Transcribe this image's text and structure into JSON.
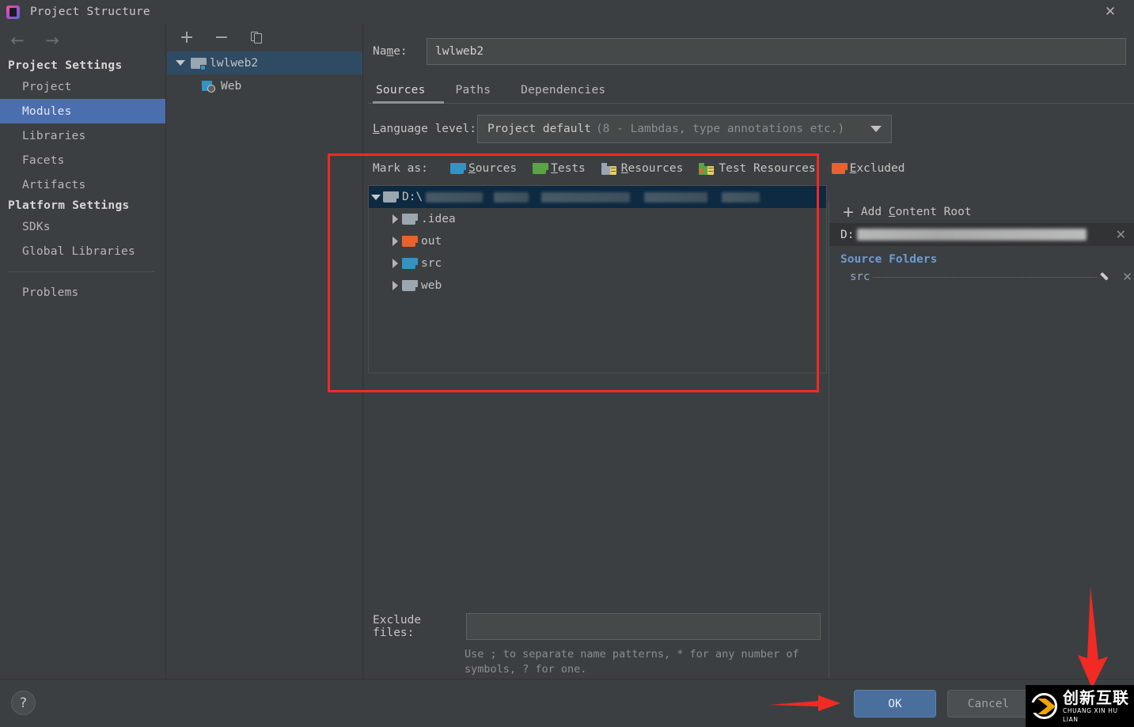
{
  "window": {
    "title": "Project Structure",
    "app_icon": "intellij-idea-icon",
    "close_label": "✕"
  },
  "sidebar": {
    "nav": {
      "back": "←",
      "forward": "→"
    },
    "groups": [
      {
        "label": "Project Settings",
        "items": [
          {
            "label": "Project",
            "selected": false
          },
          {
            "label": "Modules",
            "selected": true
          },
          {
            "label": "Libraries",
            "selected": false
          },
          {
            "label": "Facets",
            "selected": false
          },
          {
            "label": "Artifacts",
            "selected": false
          }
        ]
      },
      {
        "label": "Platform Settings",
        "items": [
          {
            "label": "SDKs",
            "selected": false
          },
          {
            "label": "Global Libraries",
            "selected": false
          }
        ]
      }
    ],
    "footer_items": [
      {
        "label": "Problems",
        "selected": false
      }
    ]
  },
  "modules_panel": {
    "toolbar": {
      "add": "+",
      "remove": "−",
      "copy_icon": "copy-icon"
    },
    "tree": [
      {
        "label": "lwlweb2",
        "icon": "module-folder-icon",
        "selected": true,
        "expanded": true,
        "depth": 0
      },
      {
        "label": "Web",
        "icon": "web-facet-icon",
        "selected": false,
        "depth": 1
      }
    ]
  },
  "main": {
    "name_label": "Name:",
    "name_value": "lwlweb2",
    "tabs": [
      {
        "label": "Sources",
        "active": true
      },
      {
        "label": "Paths",
        "active": false
      },
      {
        "label": "Dependencies",
        "active": false
      }
    ],
    "language_level": {
      "label": "Language level:",
      "value": "Project default",
      "detail": "(8 - Lambdas, type annotations etc.)"
    },
    "mark_as": {
      "label": "Mark as:",
      "options": [
        {
          "label": "Sources",
          "icon": "folder-blue-icon",
          "accel": "S"
        },
        {
          "label": "Tests",
          "icon": "folder-green-icon",
          "accel": "T"
        },
        {
          "label": "Resources",
          "icon": "resources-grey-icon",
          "accel": "R"
        },
        {
          "label": "Test Resources",
          "icon": "test-resources-icon",
          "accel": ""
        },
        {
          "label": "Excluded",
          "icon": "folder-orange-icon",
          "accel": "E"
        }
      ]
    },
    "file_tree": [
      {
        "label": "D:\\",
        "icon": "folder-grey-icon",
        "depth": 0,
        "expanded": true,
        "selected": true,
        "redacted": true
      },
      {
        "label": ".idea",
        "icon": "folder-grey-icon",
        "depth": 1,
        "expanded": false,
        "selected": false
      },
      {
        "label": "out",
        "icon": "folder-orange-icon",
        "depth": 1,
        "expanded": false,
        "selected": false
      },
      {
        "label": "src",
        "icon": "folder-blue-icon",
        "depth": 1,
        "expanded": false,
        "selected": false
      },
      {
        "label": "web",
        "icon": "folder-grey-icon",
        "depth": 1,
        "expanded": false,
        "selected": false
      }
    ],
    "exclude": {
      "label": "Exclude files:",
      "value": "",
      "placeholder": "",
      "hint": "Use ; to separate name patterns, * for any number of symbols, ? for one."
    }
  },
  "right_panel": {
    "add_content_root": "Add Content Root",
    "add_icon": "plus-icon",
    "content_root": {
      "prefix": "D:",
      "path_redacted": true,
      "remove_icon": "close-icon"
    },
    "source_folders_title": "Source Folders",
    "source_folders": [
      {
        "label": "src",
        "edit_icon": "pencil-icon",
        "remove_icon": "close-icon"
      }
    ]
  },
  "bottom": {
    "help_label": "?",
    "ok_label": "OK",
    "cancel_label": "Cancel"
  },
  "annotations": {
    "highlight_box_color": "#f12a23",
    "arrow_color": "#f12a23",
    "watermark": {
      "cn": "创新互联",
      "pinyin": "CHUANG XIN HU LIAN"
    }
  }
}
